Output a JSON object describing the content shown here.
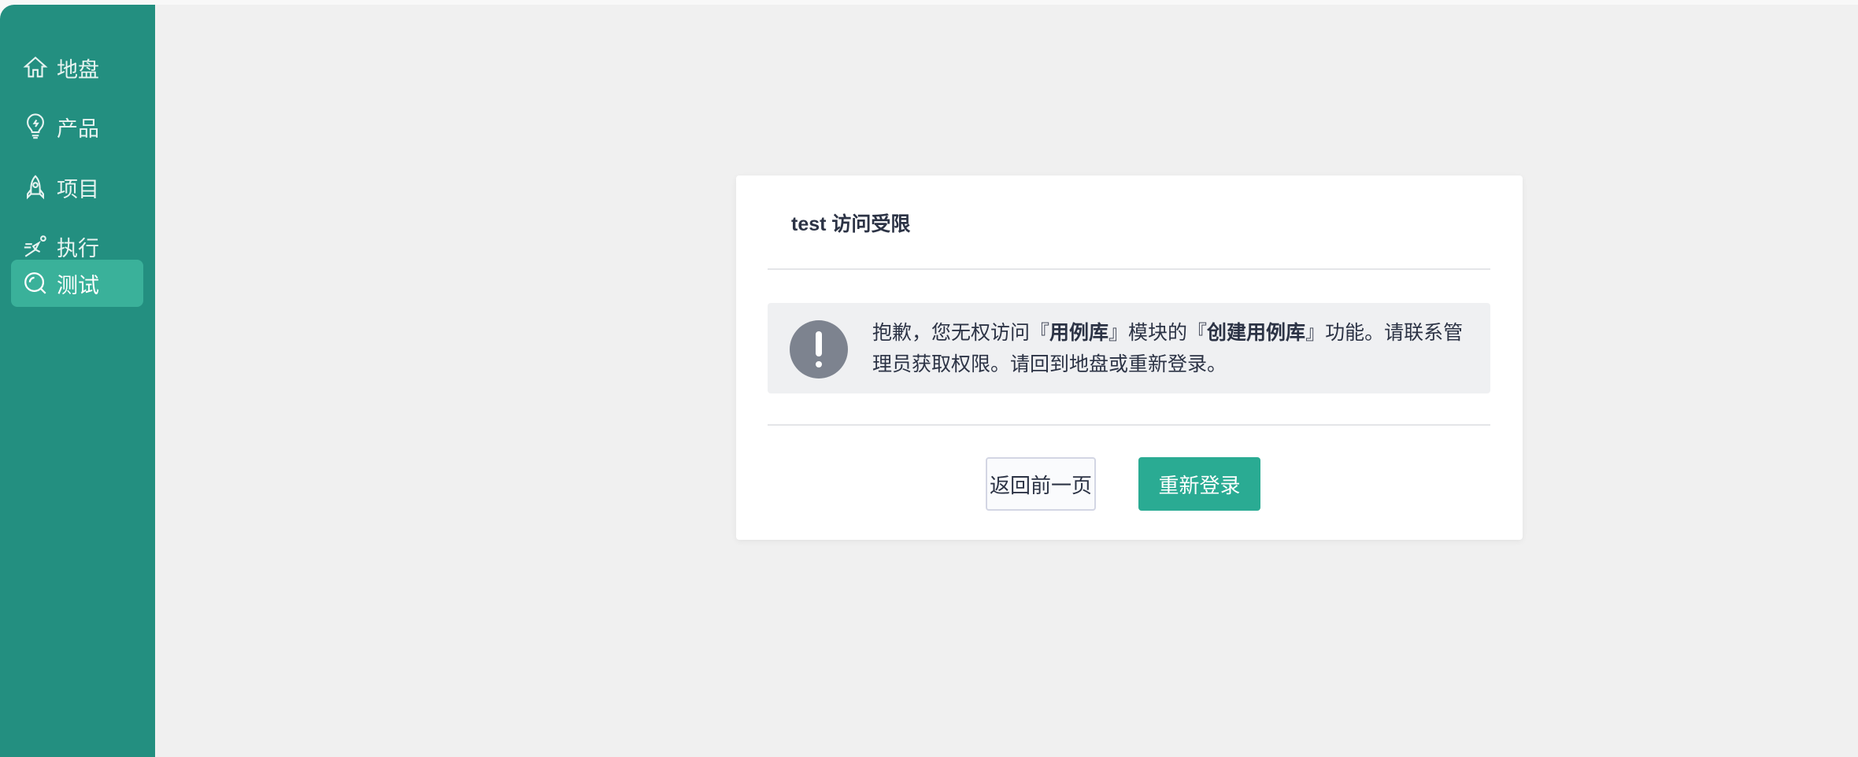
{
  "sidebar": {
    "items": [
      {
        "label": "地盘",
        "icon": "home-icon"
      },
      {
        "label": "产品",
        "icon": "lightbulb-icon"
      },
      {
        "label": "项目",
        "icon": "rocket-icon"
      },
      {
        "label": "执行",
        "icon": "running-icon"
      },
      {
        "label": "测试",
        "icon": "search-icon",
        "active": true
      }
    ]
  },
  "dialog": {
    "title": "test 访问受限",
    "message": {
      "p1": "抱歉，您无权访问『",
      "module": "用例库",
      "p2": "』模块的『",
      "feature": "创建用例库",
      "p3": "』功能。请联系管理员获取权限。请回到地盘或重新登录。"
    },
    "back_label": "返回前一页",
    "relogin_label": "重新登录"
  },
  "colors": {
    "sidebar": "#238f80",
    "active": "#3ab19a",
    "primary": "#2aab93"
  }
}
